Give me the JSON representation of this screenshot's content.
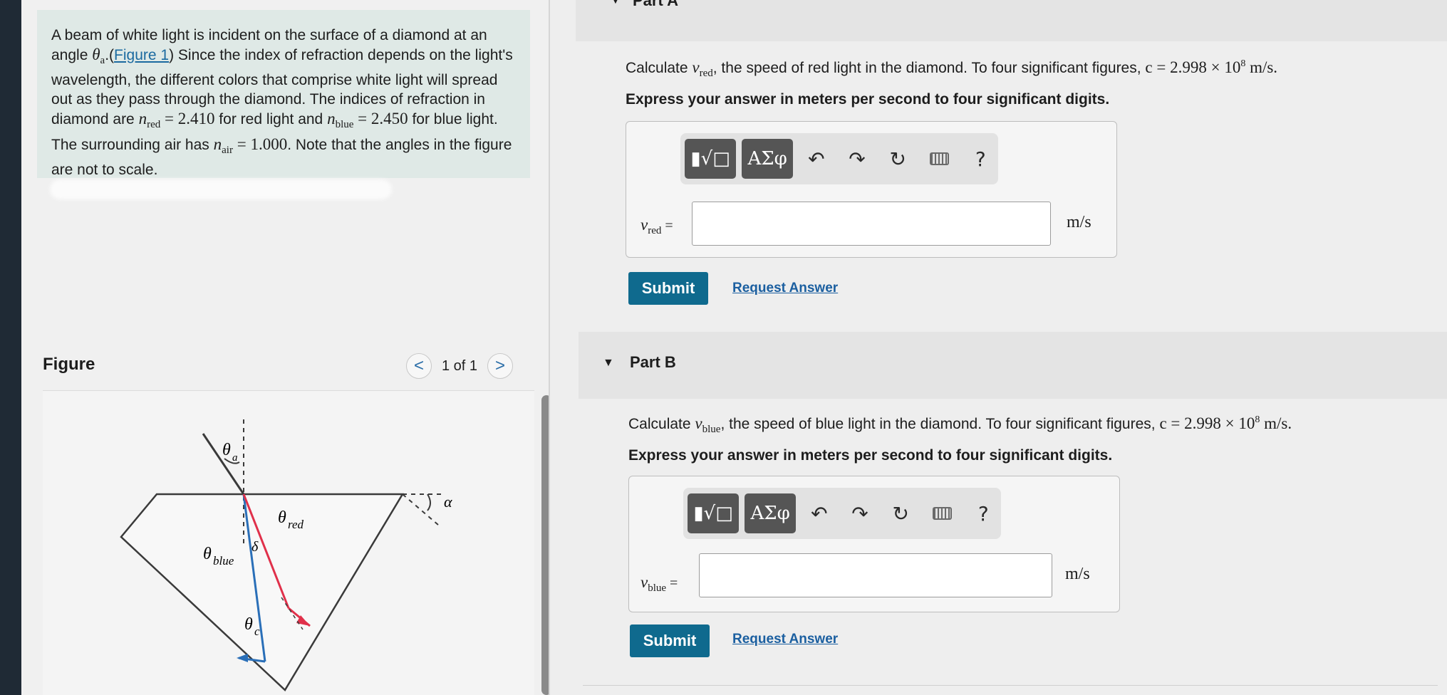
{
  "problem": {
    "t1": "A beam of white light is incident on the surface of a diamond at an angle ",
    "theta": "θ",
    "a_sub": "a",
    "t2": ".(",
    "figure_link": "Figure 1",
    "t3": ") Since the index of refraction depends on the light's wavelength, the different colors that comprise white light will spread out as they pass through the diamond. The indices of refraction in diamond are ",
    "n": "n",
    "red_sub": "red",
    "n_red_val": " = 2.410",
    "t4": " for red light and ",
    "blue_sub": "blue",
    "n_blue_val": " = 2.450",
    "t5": " for blue light. The surrounding air has ",
    "air_sub": "air",
    "n_air_val": " = 1.000",
    "t6": ". Note that the angles in the figure are not to scale."
  },
  "figure": {
    "title": "Figure",
    "pager_text": "1 of 1",
    "prev_glyph": "<",
    "next_glyph": ">",
    "labels": {
      "theta": "θ",
      "a": "a",
      "blue": "blue",
      "red": "red",
      "c": "c",
      "delta": "δ",
      "alpha": "α"
    }
  },
  "part_a": {
    "label": "Part A",
    "q1": "Calculate ",
    "v": "v",
    "red_sub": "red",
    "q2": ", the speed of red light in the diamond. To four significant figures, ",
    "c_expr": "c = 2.998 × 10",
    "exp": "8",
    "c_unit": " m/s.",
    "instruction": "Express your answer in meters per second to four significant digits.",
    "var_eq": " =",
    "unit": "m/s",
    "submit": "Submit",
    "request": "Request Answer"
  },
  "part_b": {
    "label": "Part B",
    "q1": "Calculate ",
    "v": "v",
    "blue_sub": "blue",
    "q2": ", the speed of blue light in the diamond. To four significant figures, ",
    "c_expr": "c = 2.998 × 10",
    "exp": "8",
    "c_unit": " m/s.",
    "instruction": "Express your answer in meters per second to four significant digits.",
    "var_eq": " =",
    "unit": "m/s",
    "submit": "Submit",
    "request": "Request Answer"
  },
  "toolbar": {
    "template_glyph": "▮√□",
    "greek_glyph": "ΑΣφ",
    "undo_glyph": "↶",
    "redo_glyph": "↷",
    "reset_glyph": "↻",
    "help_glyph": "?",
    "icons": [
      "templates-icon",
      "greek-symbols-icon",
      "undo-icon",
      "redo-icon",
      "reset-icon",
      "keyboard-icon",
      "help-icon"
    ]
  },
  "colors": {
    "problem_bg": "#dfe9e6",
    "submit_bg": "#0f6a8e",
    "link": "#1b6aa0",
    "red_ray": "#e0304a",
    "blue_ray": "#2a6fb8"
  }
}
